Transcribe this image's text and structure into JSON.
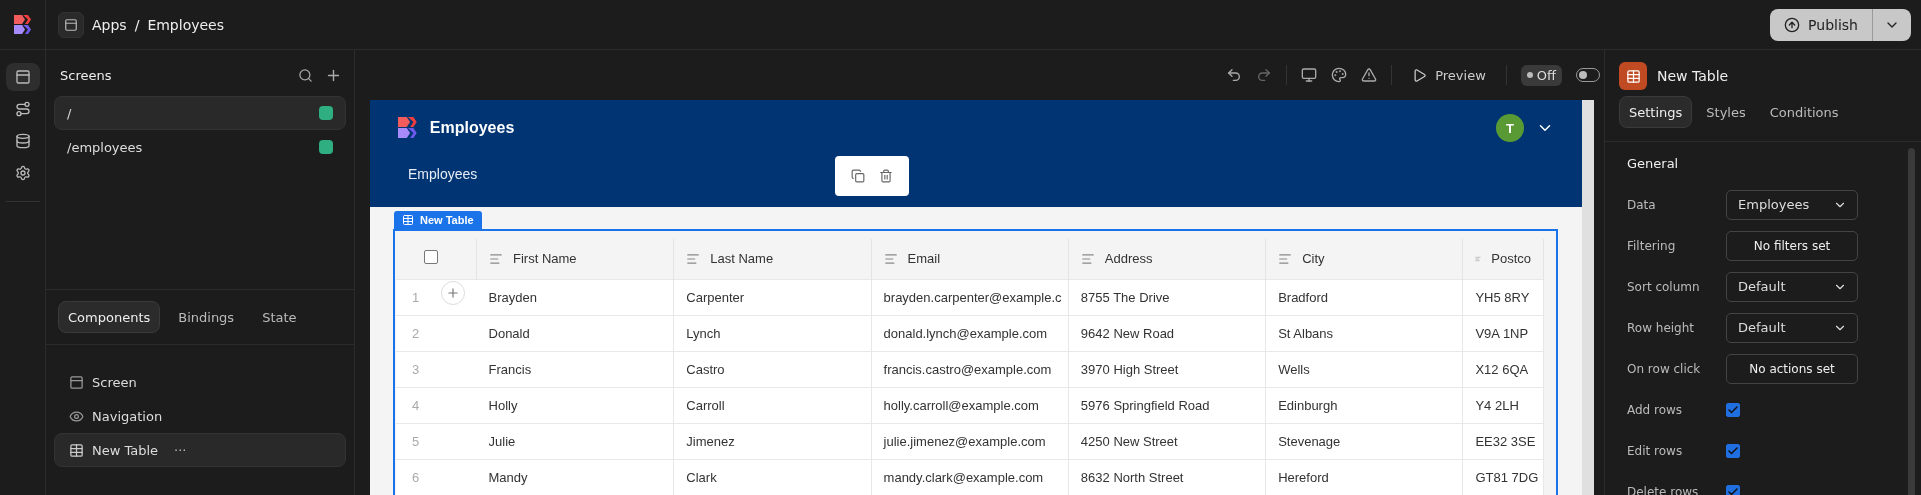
{
  "topbar": {
    "breadcrumb": [
      "Apps",
      "Employees"
    ],
    "separator": "/",
    "publish": "Publish"
  },
  "rail": [
    {
      "kind": "screens",
      "selected": true
    },
    {
      "kind": "flows",
      "selected": false
    },
    {
      "kind": "data",
      "selected": false
    },
    {
      "kind": "settings",
      "selected": false
    }
  ],
  "screens": {
    "title": "Screens",
    "items": [
      {
        "path": "/",
        "selected": true
      },
      {
        "path": "/employees",
        "selected": false
      }
    ]
  },
  "panel_tabs": [
    {
      "label": "Components",
      "selected": true
    },
    {
      "label": "Bindings",
      "selected": false
    },
    {
      "label": "State",
      "selected": false
    }
  ],
  "components": [
    {
      "kind": "screen",
      "label": "Screen",
      "selected": false
    },
    {
      "kind": "navigation",
      "label": "Navigation",
      "selected": false
    },
    {
      "kind": "table",
      "label": "New Table",
      "selected": true,
      "more": "···"
    }
  ],
  "canvas_toolbar": {
    "preview": "Preview",
    "toggle": {
      "label": "Off",
      "on": false
    }
  },
  "app": {
    "title": "Employees",
    "avatar": "T",
    "nav": [
      "Employees"
    ],
    "table_label": "New Table",
    "select_all": {
      "checked": false
    },
    "columns": [
      "First Name",
      "Last Name",
      "Email",
      "Address",
      "City",
      "Postco"
    ],
    "rows": [
      {
        "index": "1",
        "cells": [
          "Brayden",
          "Carpenter",
          "brayden.carpenter@example.c",
          "8755 The Drive",
          "Bradford",
          "YH5 8RY"
        ]
      },
      {
        "index": "2",
        "cells": [
          "Donald",
          "Lynch",
          "donald.lynch@example.com",
          "9642 New Road",
          "St Albans",
          "V9A 1NP"
        ]
      },
      {
        "index": "3",
        "cells": [
          "Francis",
          "Castro",
          "francis.castro@example.com",
          "3970 High Street",
          "Wells",
          "X12 6QA"
        ]
      },
      {
        "index": "4",
        "cells": [
          "Holly",
          "Carroll",
          "holly.carroll@example.com",
          "5976 Springfield Road",
          "Edinburgh",
          "Y4 2LH"
        ]
      },
      {
        "index": "5",
        "cells": [
          "Julie",
          "Jimenez",
          "julie.jimenez@example.com",
          "4250 New Street",
          "Stevenage",
          "EE32 3SE"
        ]
      },
      {
        "index": "6",
        "cells": [
          "Mandy",
          "Clark",
          "mandy.clark@example.com",
          "8632 North Street",
          "Hereford",
          "GT81 7DG"
        ]
      }
    ]
  },
  "inspector": {
    "title": "New Table",
    "tabs": [
      {
        "label": "Settings",
        "selected": true
      },
      {
        "label": "Styles",
        "selected": false
      },
      {
        "label": "Conditions",
        "selected": false
      }
    ],
    "section": "General",
    "fields": [
      {
        "kind": "select",
        "label": "Data",
        "value": "Employees"
      },
      {
        "kind": "button",
        "label": "Filtering",
        "value": "No filters set"
      },
      {
        "kind": "select",
        "label": "Sort column",
        "value": "Default"
      },
      {
        "kind": "select",
        "label": "Row height",
        "value": "Default"
      },
      {
        "kind": "button",
        "label": "On row click",
        "value": "No actions set"
      },
      {
        "kind": "checkbox",
        "label": "Add rows",
        "checked": true
      },
      {
        "kind": "checkbox",
        "label": "Edit rows",
        "checked": true
      },
      {
        "kind": "checkbox",
        "label": "Delete rows",
        "checked": true
      }
    ]
  }
}
